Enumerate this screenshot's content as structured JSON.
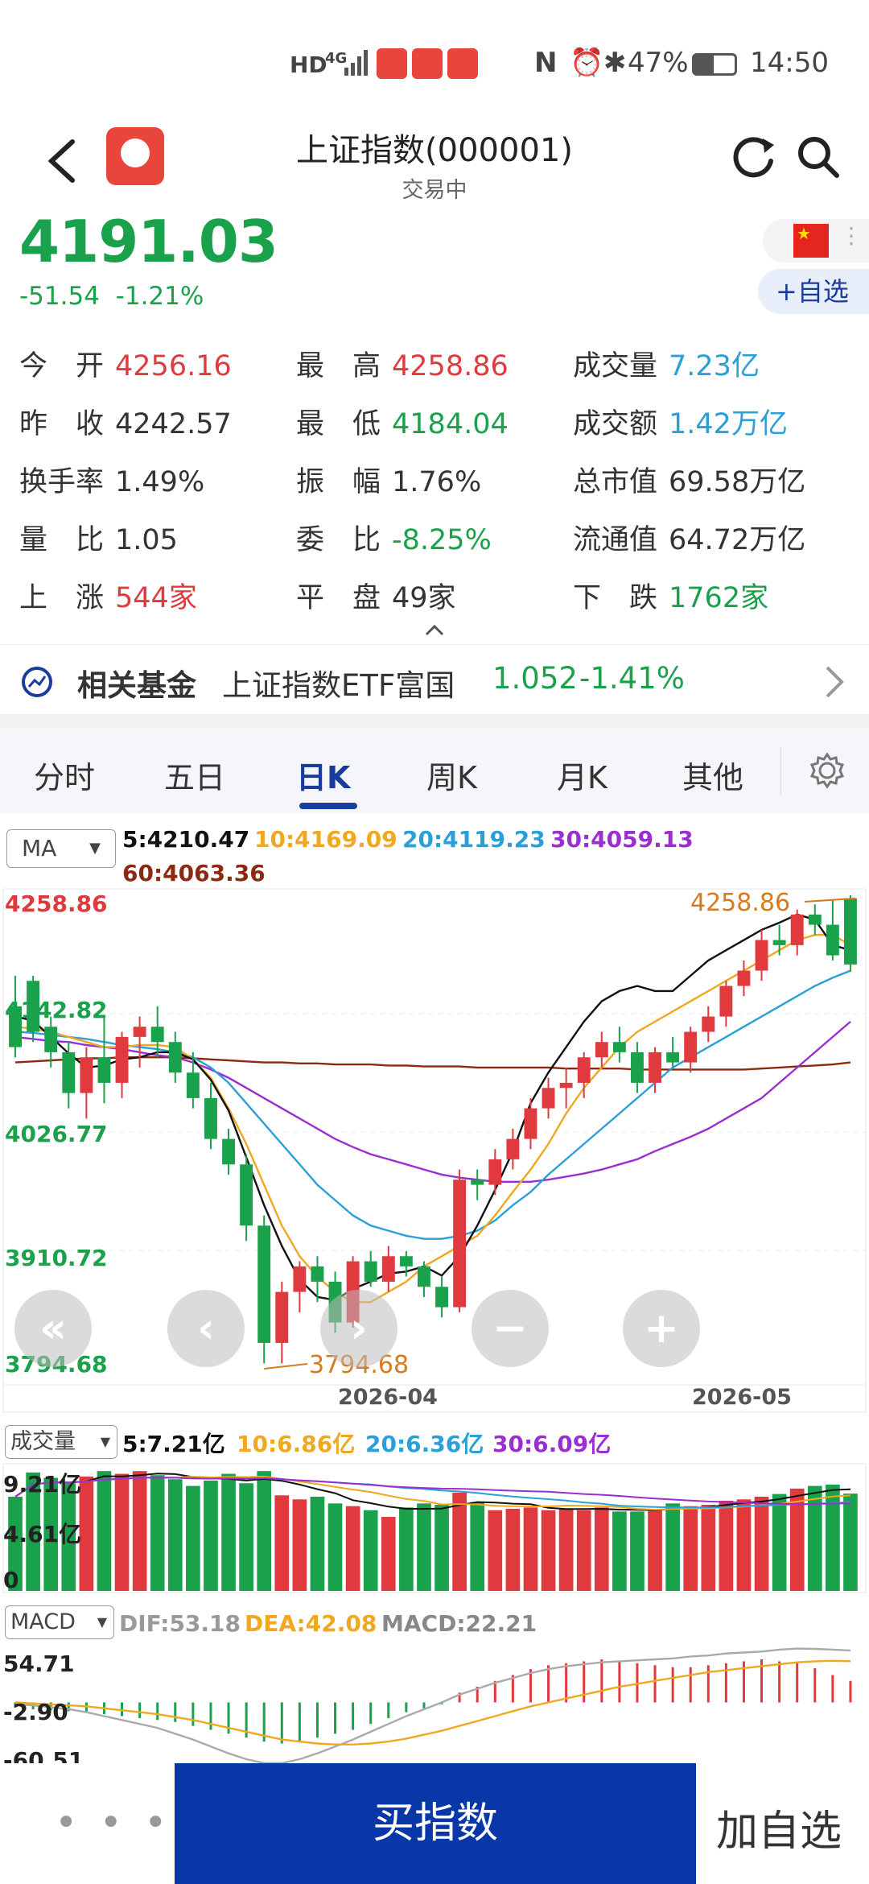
{
  "status_bar": {
    "network": "HD",
    "signal": "4G",
    "battery": "47%",
    "time": "14:50"
  },
  "header": {
    "title": "上证指数(000001)",
    "subtitle": "交易中",
    "add_watch": "+自选"
  },
  "quote": {
    "price": "4191.03",
    "change": "-51.54",
    "change_pct": "-1.21%"
  },
  "stats": [
    [
      {
        "label": "今　开",
        "value": "4256.16",
        "color": "red"
      },
      {
        "label": "最　高",
        "value": "4258.86",
        "color": "red"
      },
      {
        "label": "成交量",
        "value": "7.23亿",
        "color": "blue"
      }
    ],
    [
      {
        "label": "昨　收",
        "value": "4242.57",
        "color": "plain"
      },
      {
        "label": "最　低",
        "value": "4184.04",
        "color": "green"
      },
      {
        "label": "成交额",
        "value": "1.42万亿",
        "color": "blue"
      }
    ],
    [
      {
        "label": "换手率",
        "value": "1.49%",
        "color": "plain"
      },
      {
        "label": "振　幅",
        "value": "1.76%",
        "color": "plain"
      },
      {
        "label": "总市值",
        "value": "69.58万亿",
        "color": "plain"
      }
    ],
    [
      {
        "label": "量　比",
        "value": "1.05",
        "color": "plain"
      },
      {
        "label": "委　比",
        "value": "-8.25%",
        "color": "green"
      },
      {
        "label": "流通值",
        "value": "64.72万亿",
        "color": "plain"
      }
    ],
    [
      {
        "label": "上　涨",
        "value": "544家",
        "color": "red"
      },
      {
        "label": "平　盘",
        "value": "49家",
        "color": "plain"
      },
      {
        "label": "下　跌",
        "value": "1762家",
        "color": "green"
      }
    ]
  ],
  "fund": {
    "label": "相关基金",
    "name": "上证指数ETF富国",
    "price": "1.052",
    "change": "-1.41%"
  },
  "tabs": [
    "分时",
    "五日",
    "日K",
    "周K",
    "月K",
    "其他"
  ],
  "active_tab": "日K",
  "ma_legend": {
    "selector": "MA",
    "ma5": "5:4210.47",
    "ma10": "10:4169.09",
    "ma20": "20:4119.23",
    "ma30": "30:4059.13",
    "ma60": "60:4063.36"
  },
  "kline_axis": {
    "high": "4258.86",
    "y2": "4142.82",
    "y3": "4026.77",
    "y4": "3910.72",
    "low": "3794.68",
    "max_marker": "4258.86",
    "min_marker": "3794.68",
    "x_labels": [
      "2026-04",
      "2026-05"
    ]
  },
  "volume_legend": {
    "selector": "成交量",
    "v5": "5:7.21亿",
    "v10": "10:6.86亿",
    "v20": "20:6.36亿",
    "v30": "30:6.09亿",
    "axis_top": "9.21亿",
    "axis_mid": "4.61亿",
    "axis_zero": "0"
  },
  "macd_legend": {
    "selector": "MACD",
    "dif": "DIF:53.18",
    "dea": "DEA:42.08",
    "macd": "MACD:22.21",
    "axis_top": "54.71",
    "axis_mid": "-2.90",
    "axis_bottom": "-60.51"
  },
  "bottom": {
    "more": "• • •",
    "buy": "买指数",
    "watch": "加自选"
  },
  "colors": {
    "up": "#e0393e",
    "down": "#1aa14c",
    "brand": "#0a37a8",
    "ma5": "#111111",
    "ma10": "#f0a820",
    "ma20": "#2a9fd8",
    "ma30": "#9a2ed0",
    "ma60": "#8a2a10"
  },
  "chart_data": {
    "type": "candlestick",
    "candles": [
      [
        4150,
        4180,
        4100,
        4110
      ],
      [
        4175,
        4180,
        4115,
        4125
      ],
      [
        4130,
        4140,
        4090,
        4105
      ],
      [
        4105,
        4115,
        4050,
        4065
      ],
      [
        4065,
        4110,
        4040,
        4100
      ],
      [
        4100,
        4140,
        4055,
        4075
      ],
      [
        4075,
        4125,
        4060,
        4120
      ],
      [
        4120,
        4140,
        4090,
        4130
      ],
      [
        4130,
        4150,
        4100,
        4115
      ],
      [
        4115,
        4125,
        4075,
        4085
      ],
      [
        4085,
        4105,
        4050,
        4060
      ],
      [
        4060,
        4075,
        4010,
        4020
      ],
      [
        4020,
        4030,
        3985,
        3995
      ],
      [
        3995,
        4005,
        3920,
        3935
      ],
      [
        3935,
        3945,
        3800,
        3820
      ],
      [
        3820,
        3880,
        3800,
        3870
      ],
      [
        3870,
        3900,
        3850,
        3895
      ],
      [
        3895,
        3905,
        3860,
        3880
      ],
      [
        3880,
        3890,
        3830,
        3840
      ],
      [
        3840,
        3905,
        3835,
        3900
      ],
      [
        3900,
        3910,
        3875,
        3880
      ],
      [
        3880,
        3915,
        3870,
        3905
      ],
      [
        3905,
        3910,
        3885,
        3895
      ],
      [
        3895,
        3900,
        3865,
        3875
      ],
      [
        3875,
        3885,
        3845,
        3855
      ],
      [
        3855,
        3990,
        3850,
        3980
      ],
      [
        3980,
        3990,
        3960,
        3975
      ],
      [
        3975,
        4010,
        3965,
        4000
      ],
      [
        4000,
        4030,
        3990,
        4020
      ],
      [
        4020,
        4060,
        4010,
        4050
      ],
      [
        4050,
        4080,
        4040,
        4070
      ],
      [
        4070,
        4090,
        4050,
        4075
      ],
      [
        4075,
        4105,
        4060,
        4100
      ],
      [
        4100,
        4125,
        4090,
        4115
      ],
      [
        4115,
        4130,
        4095,
        4105
      ],
      [
        4105,
        4115,
        4065,
        4075
      ],
      [
        4075,
        4110,
        4065,
        4105
      ],
      [
        4105,
        4120,
        4090,
        4095
      ],
      [
        4095,
        4130,
        4085,
        4125
      ],
      [
        4125,
        4150,
        4115,
        4140
      ],
      [
        4140,
        4175,
        4130,
        4170
      ],
      [
        4170,
        4195,
        4160,
        4185
      ],
      [
        4185,
        4225,
        4175,
        4215
      ],
      [
        4215,
        4230,
        4200,
        4210
      ],
      [
        4210,
        4245,
        4200,
        4240
      ],
      [
        4240,
        4250,
        4220,
        4230
      ],
      [
        4230,
        4255,
        4195,
        4200
      ],
      [
        4256,
        4259,
        4184,
        4191
      ]
    ],
    "ma5": [
      4140,
      4136,
      4120,
      4104,
      4090,
      4092,
      4098,
      4100,
      4105,
      4105,
      4098,
      4078,
      4048,
      4002,
      3955,
      3915,
      3882,
      3865,
      3862,
      3873,
      3880,
      3888,
      3890,
      3895,
      3886,
      3905,
      3935,
      3970,
      4008,
      4055,
      4085,
      4110,
      4135,
      4155,
      4165,
      4170,
      4165,
      4165,
      4180,
      4195,
      4205,
      4215,
      4225,
      4232,
      4240,
      4235,
      4210,
      4205
    ],
    "ma10": [
      4130,
      4128,
      4125,
      4120,
      4115,
      4110,
      4110,
      4112,
      4112,
      4110,
      4098,
      4080,
      4050,
      4015,
      3975,
      3935,
      3905,
      3885,
      3870,
      3860,
      3860,
      3870,
      3880,
      3895,
      3905,
      3915,
      3925,
      3945,
      3968,
      3990,
      4015,
      4045,
      4070,
      4090,
      4110,
      4125,
      4135,
      4145,
      4155,
      4165,
      4175,
      4185,
      4195,
      4205,
      4215,
      4220,
      4220,
      4210
    ],
    "ma20": [
      4125,
      4124,
      4122,
      4120,
      4118,
      4115,
      4112,
      4110,
      4108,
      4105,
      4100,
      4090,
      4075,
      4055,
      4035,
      4015,
      3995,
      3975,
      3960,
      3945,
      3935,
      3930,
      3925,
      3922,
      3922,
      3925,
      3930,
      3940,
      3955,
      3968,
      3985,
      4000,
      4015,
      4030,
      4045,
      4060,
      4075,
      4090,
      4100,
      4110,
      4120,
      4130,
      4140,
      4150,
      4160,
      4170,
      4178,
      4185
    ],
    "ma30": [
      4120,
      4118,
      4116,
      4115,
      4112,
      4110,
      4108,
      4105,
      4102,
      4100,
      4095,
      4088,
      4080,
      4070,
      4060,
      4050,
      4040,
      4030,
      4020,
      4012,
      4005,
      4000,
      3995,
      3990,
      3985,
      3982,
      3980,
      3978,
      3978,
      3978,
      3980,
      3983,
      3986,
      3990,
      3995,
      4000,
      4008,
      4015,
      4022,
      4030,
      4040,
      4050,
      4060,
      4075,
      4090,
      4105,
      4120,
      4135
    ],
    "ma60": [
      4095,
      4096,
      4097,
      4098,
      4099,
      4099,
      4100,
      4100,
      4100,
      4100,
      4099,
      4098,
      4097,
      4096,
      4095,
      4095,
      4094,
      4094,
      4093,
      4093,
      4093,
      4092,
      4092,
      4091,
      4091,
      4091,
      4090,
      4090,
      4090,
      4090,
      4090,
      4089,
      4089,
      4089,
      4089,
      4088,
      4088,
      4088,
      4088,
      4088,
      4088,
      4088,
      4089,
      4090,
      4091,
      4092,
      4093,
      4095
    ],
    "volume": [
      7.0,
      8.8,
      8.4,
      8.0,
      8.5,
      8.9,
      8.7,
      8.9,
      8.6,
      8.3,
      7.8,
      8.2,
      8.7,
      8.0,
      8.9,
      7.1,
      6.8,
      7.0,
      6.5,
      6.3,
      6.0,
      5.5,
      6.2,
      6.5,
      6.4,
      7.3,
      6.6,
      6.0,
      6.1,
      6.2,
      6.0,
      6.1,
      6.0,
      6.2,
      5.9,
      5.9,
      6.0,
      6.5,
      6.3,
      6.4,
      6.7,
      6.8,
      7.0,
      7.2,
      7.6,
      7.8,
      7.9,
      7.23
    ],
    "macd_hist": [
      -5,
      -7,
      -8,
      -9,
      -10,
      -12,
      -14,
      -16,
      -18,
      -20,
      -24,
      -28,
      -32,
      -36,
      -40,
      -42,
      -40,
      -36,
      -32,
      -28,
      -22,
      -16,
      -10,
      -6,
      -2,
      10,
      16,
      22,
      28,
      34,
      38,
      40,
      42,
      44,
      42,
      40,
      38,
      36,
      36,
      38,
      40,
      42,
      44,
      42,
      40,
      35,
      28,
      22
    ],
    "dif": [
      -2,
      -3,
      -5,
      -7,
      -10,
      -14,
      -18,
      -22,
      -26,
      -32,
      -38,
      -45,
      -52,
      -58,
      -62,
      -62,
      -58,
      -52,
      -45,
      -38,
      -30,
      -22,
      -14,
      -7,
      0,
      8,
      14,
      20,
      25,
      30,
      34,
      37,
      39,
      41,
      42,
      43,
      44,
      45,
      47,
      48,
      50,
      51,
      52,
      54,
      55,
      54.7,
      54,
      53.18
    ],
    "dea": [
      0,
      -1,
      -2,
      -3,
      -4,
      -6,
      -8,
      -10,
      -12,
      -15,
      -18,
      -22,
      -26,
      -30,
      -34,
      -38,
      -40,
      -42,
      -43,
      -43,
      -42,
      -40,
      -37,
      -33,
      -29,
      -24,
      -19,
      -14,
      -9,
      -4,
      0,
      4,
      8,
      12,
      16,
      19,
      22,
      25,
      28,
      31,
      33,
      35,
      37,
      39,
      41,
      42,
      42.5,
      42.08
    ]
  }
}
